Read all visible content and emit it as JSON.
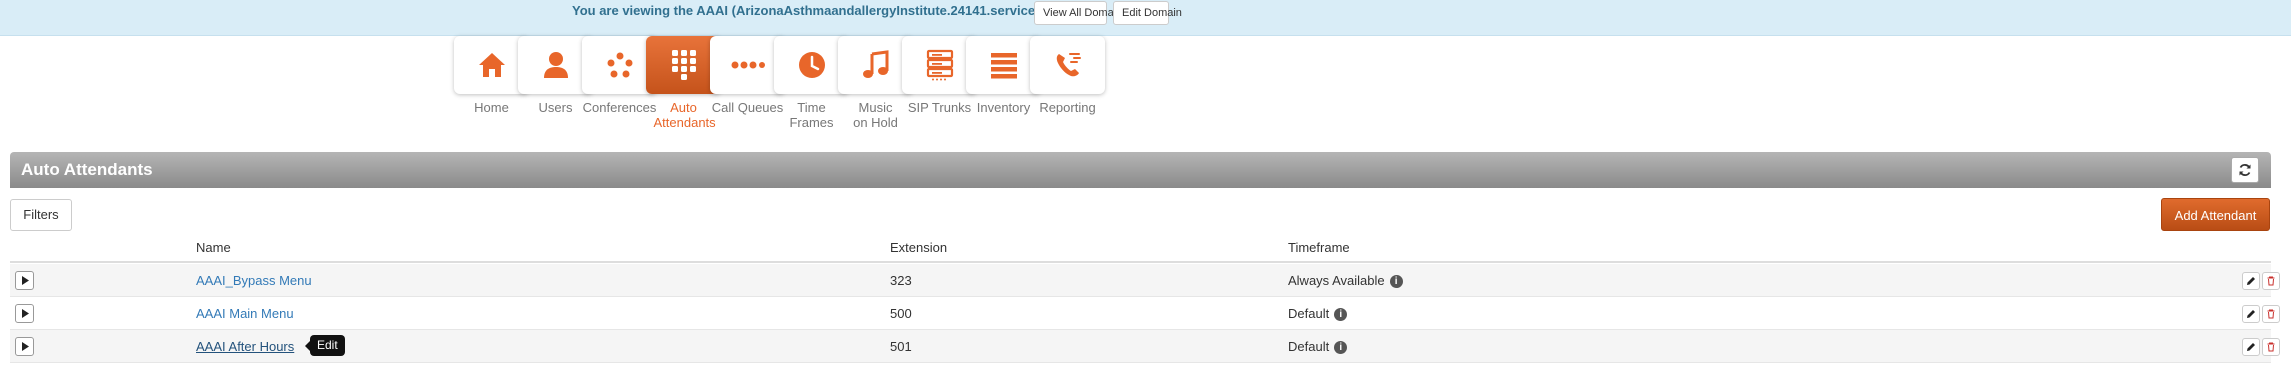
{
  "banner": {
    "message": "You are viewing the AAAI (ArizonaAsthmaandallergyInstitute.24141.service) domain.",
    "view_all_label": "View All Domains",
    "edit_domain_label": "Edit Domain"
  },
  "nav": {
    "items": [
      {
        "label": "Home",
        "icon": "home-icon"
      },
      {
        "label": "Users",
        "icon": "user-icon"
      },
      {
        "label": "Conferences",
        "icon": "conference-icon"
      },
      {
        "label": "Auto Attendants",
        "icon": "keypad-icon",
        "active": true
      },
      {
        "label": "Call Queues",
        "icon": "queue-dots-icon"
      },
      {
        "label": "Time Frames",
        "icon": "clock-icon"
      },
      {
        "label": "Music on Hold",
        "icon": "music-note-icon"
      },
      {
        "label": "SIP Trunks",
        "icon": "server-icon"
      },
      {
        "label": "Inventory",
        "icon": "list-icon"
      },
      {
        "label": "Reporting",
        "icon": "phone-reporting-icon"
      }
    ],
    "accent_color": "#e8662a"
  },
  "panel": {
    "title": "Auto Attendants",
    "filters_label": "Filters",
    "add_label": "Add Attendant"
  },
  "table": {
    "headers": {
      "name": "Name",
      "extension": "Extension",
      "timeframe": "Timeframe"
    },
    "rows": [
      {
        "name": "AAAI_Bypass Menu",
        "extension": "323",
        "timeframe": "Always Available"
      },
      {
        "name": "AAAI Main Menu",
        "extension": "500",
        "timeframe": "Default"
      },
      {
        "name": "AAAI After Hours",
        "extension": "501",
        "timeframe": "Default"
      }
    ]
  },
  "tooltip": {
    "text": "Edit"
  }
}
